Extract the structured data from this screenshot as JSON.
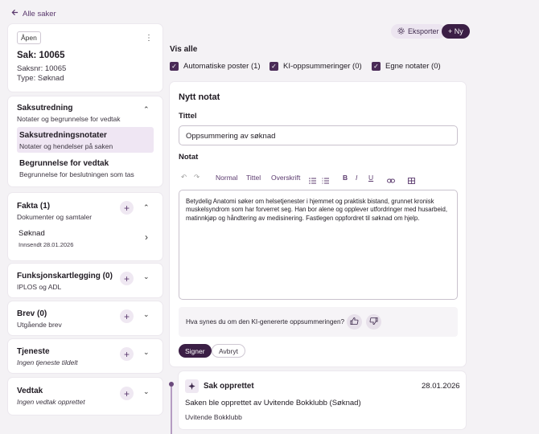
{
  "nav": {
    "back_label": "Alle saker"
  },
  "case_card": {
    "status": "Åpen",
    "title": "Sak: 10065",
    "case_no": "Saksnr: 10065",
    "type": "Type: Søknad"
  },
  "saksutredning": {
    "title": "Saksutredning",
    "subtitle": "Notater og begrunnelse for vedtak",
    "items": [
      {
        "title": "Saksutredningsnotater",
        "subtitle": "Notater og hendelser på saken"
      },
      {
        "title": "Begrunnelse for vedtak",
        "subtitle": "Begrunnelse for beslutningen som tas"
      }
    ]
  },
  "fakta": {
    "title": "Fakta (1)",
    "subtitle": "Dokumenter og samtaler",
    "item_title": "Søknad",
    "item_sub": "Innsendt 28.01.2026"
  },
  "funksjon": {
    "title": "Funksjonskartlegging (0)",
    "subtitle": "IPLOS og ADL"
  },
  "brev": {
    "title": "Brev (0)",
    "subtitle": "Utgående brev"
  },
  "tjeneste": {
    "title": "Tjeneste",
    "subtitle": "Ingen tjeneste tildelt"
  },
  "vedtak": {
    "title": "Vedtak",
    "subtitle": "Ingen vedtak opprettet"
  },
  "toolbar": {
    "export_label": "Eksporter",
    "new_label": "+ Ny"
  },
  "filters": {
    "title": "Vis alle",
    "items": [
      "Automatiske poster (1)",
      "KI-oppsummeringer (0)",
      "Egne notater (0)"
    ]
  },
  "note": {
    "heading": "Nytt notat",
    "title_label": "Tittel",
    "title_value": "Oppsummering av søknad",
    "note_label": "Notat",
    "format_normal": "Normal",
    "format_title": "Tittel",
    "format_heading": "Overskrift",
    "bold": "B",
    "italic": "I",
    "underline": "U",
    "body": "Betydelig Anatomi søker om helsetjenester i hjemmet og praktisk bistand, grunnet kronisk muskelsyndrom som har forverret seg. Han bor alene og opplever utfordringer med husarbeid, matinnkjøp og håndtering av medisinering. Fastlegen oppfordret til søknad om hjelp.",
    "feedback_q": "Hva synes du om den KI-genererte oppsummeringen?",
    "sign_label": "Signer",
    "cancel_label": "Avbryt"
  },
  "timeline": {
    "title": "Sak opprettet",
    "date": "28.01.2026",
    "body": "Saken ble opprettet av Uvitende Bokklubb (Søknad)",
    "author": "Uvitende Bokklubb"
  },
  "colors": {
    "accent": "#3b1f45",
    "selected": "#efe6f3",
    "background": "#f4f2f5"
  }
}
